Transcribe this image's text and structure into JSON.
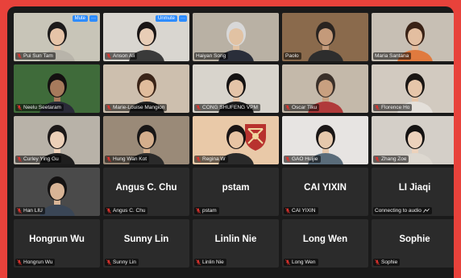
{
  "participants": [
    {
      "name": "Pui Sun Tam",
      "video": true,
      "active": true,
      "button": "Mute",
      "mic": "off",
      "bg": "#c8c5b8",
      "skin": "#e6c4a8",
      "hair": "#1c1a1a",
      "shirt": "#b8b4aa"
    },
    {
      "name": "Anson Ali",
      "video": true,
      "button": "Unmute",
      "mic": "off",
      "bg": "#d9d6d0",
      "skin": "#e8cdb6",
      "hair": "#1a1616",
      "shirt": "#3a3a3a"
    },
    {
      "name": "Haiyan Song",
      "video": true,
      "mic": "none",
      "bg": "#b9b1a4",
      "skin": "#e1c2a3",
      "hair": "#d8d8d8",
      "shirt": "#2a2e3a"
    },
    {
      "name": "Paolo",
      "video": true,
      "mic": "none",
      "bg": "#8a6a4c",
      "skin": "#c49a7a",
      "hair": "#2a2420",
      "shirt": "#2d2d2d"
    },
    {
      "name": "Maria Santana",
      "video": true,
      "mic": "none",
      "bg": "#c7bfb4",
      "skin": "#e3bea0",
      "hair": "#3a2216",
      "shirt": "#e07a3e"
    },
    {
      "name": "Neelu Seetaram",
      "video": true,
      "mic": "off",
      "bg": "#3f6b3a",
      "skin": "#a67a5c",
      "hair": "#141010",
      "shirt": "#2a2a38"
    },
    {
      "name": "Marie-Louise Mangion",
      "video": true,
      "mic": "off",
      "bg": "#cdbfae",
      "skin": "#e0bc9c",
      "hair": "#3a2418",
      "shirt": "#202020"
    },
    {
      "name": "CONG SHUFENG VPM",
      "video": true,
      "mic": "off",
      "bg": "#d8d4cc",
      "skin": "#e4c4a8",
      "hair": "#141212",
      "shirt": "#1c1c1c"
    },
    {
      "name": "Oscar Tiku",
      "video": true,
      "mic": "off",
      "bg": "#c4b9aa",
      "skin": "#c8a080",
      "hair": "#3a302a",
      "shirt": "#b03a3a"
    },
    {
      "name": "Florence Ho",
      "video": true,
      "mic": "off",
      "bg": "#d2cac0",
      "skin": "#e6c6aa",
      "hair": "#1a1614",
      "shirt": "#e4e0da"
    },
    {
      "name": "Curley Ying Gu",
      "video": true,
      "mic": "off",
      "bg": "#b8b2a8",
      "skin": "#ecd0b8",
      "hair": "#1c1818",
      "shirt": "#1e1e1e"
    },
    {
      "name": "Hung Wan Kot",
      "video": true,
      "mic": "off",
      "bg": "#9a8a78",
      "skin": "#d4ae8c",
      "hair": "#181616",
      "shirt": "#2a2a2a"
    },
    {
      "name": "Regina W",
      "video": true,
      "mic": "off",
      "bg": "#e9c9a8",
      "skin": "#e8c4a4",
      "hair": "#1a1414",
      "shirt": "#2a2a2a",
      "logo": true
    },
    {
      "name": "GAO Huijie",
      "video": true,
      "mic": "off",
      "bg": "#e7e4e2",
      "skin": "#e6c8ac",
      "hair": "#1a1616",
      "shirt": "#5a6c7a"
    },
    {
      "name": "Zhang Zoe",
      "video": true,
      "mic": "off",
      "bg": "#d4cfc8",
      "skin": "#ecd2bc",
      "hair": "#141212",
      "shirt": "#ddd8d0"
    },
    {
      "name": "Han LIU",
      "video": true,
      "mic": "off",
      "bg": "#4a4a4a",
      "skin": "#d8b496",
      "hair": "#141212",
      "shirt": "#3a4656"
    },
    {
      "name": "Angus C. Chu",
      "video": false,
      "mic": "off"
    },
    {
      "name": "pstam",
      "video": false,
      "mic": "off"
    },
    {
      "name": "CAI YIXIN",
      "video": false,
      "mic": "off"
    },
    {
      "name": "Connecting to audio",
      "display": "LI Jiaqi",
      "video": false,
      "mic": "connecting"
    },
    {
      "name": "Hongrun Wu",
      "video": false,
      "mic": "off"
    },
    {
      "name": "Sunny Lin",
      "video": false,
      "mic": "off"
    },
    {
      "name": "Linlin Nie",
      "video": false,
      "mic": "off"
    },
    {
      "name": "Long Wen",
      "video": false,
      "mic": "off"
    },
    {
      "name": "Sophie",
      "video": false,
      "mic": "off"
    }
  ],
  "colors": {
    "accent": "#2d8cff",
    "active_border": "#c7e45a",
    "mic_off": "#e0322d",
    "background": "#e8423b"
  }
}
